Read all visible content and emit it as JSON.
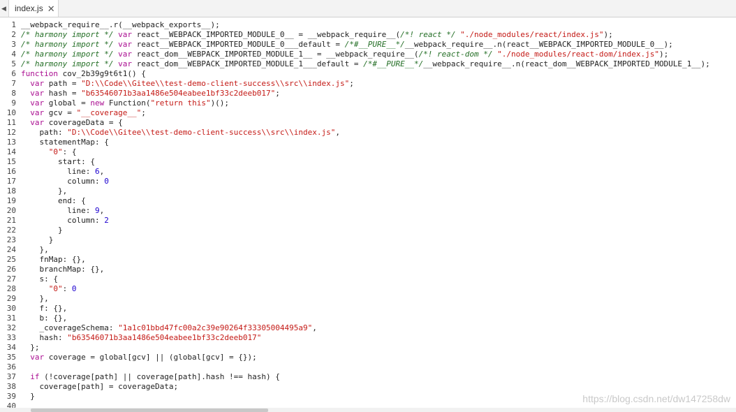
{
  "tab": {
    "filename": "index.js",
    "close_glyph": "✕",
    "toggle_glyph": "◀"
  },
  "watermark": "https://blog.csdn.net/dw147258dw",
  "lines": [
    [
      [
        "id",
        "__webpack_require__.r(__webpack_exports__);"
      ]
    ],
    [
      [
        "cm",
        "/* harmony import */ "
      ],
      [
        "kw",
        "var "
      ],
      [
        "id",
        "react__WEBPACK_IMPORTED_MODULE_0__ = __webpack_require__("
      ],
      [
        "cm",
        "/*! react */ "
      ],
      [
        "str",
        "\"./node_modules/react/index.js\""
      ],
      [
        "id",
        ");"
      ]
    ],
    [
      [
        "cm",
        "/* harmony import */ "
      ],
      [
        "kw",
        "var "
      ],
      [
        "id",
        "react__WEBPACK_IMPORTED_MODULE_0___default = "
      ],
      [
        "cm",
        "/*#__PURE__*/"
      ],
      [
        "id",
        "__webpack_require__.n(react__WEBPACK_IMPORTED_MODULE_0__);"
      ]
    ],
    [
      [
        "cm",
        "/* harmony import */ "
      ],
      [
        "kw",
        "var "
      ],
      [
        "id",
        "react_dom__WEBPACK_IMPORTED_MODULE_1__ = __webpack_require__("
      ],
      [
        "cm",
        "/*! react-dom */ "
      ],
      [
        "str",
        "\"./node_modules/react-dom/index.js\""
      ],
      [
        "id",
        ");"
      ]
    ],
    [
      [
        "cm",
        "/* harmony import */ "
      ],
      [
        "kw",
        "var "
      ],
      [
        "id",
        "react_dom__WEBPACK_IMPORTED_MODULE_1___default = "
      ],
      [
        "cm",
        "/*#__PURE__*/"
      ],
      [
        "id",
        "__webpack_require__.n(react_dom__WEBPACK_IMPORTED_MODULE_1__);"
      ]
    ],
    [
      [
        "kw",
        "function "
      ],
      [
        "id",
        "cov_2b39g9t6t1() {"
      ]
    ],
    [
      [
        "id",
        "  "
      ],
      [
        "kw",
        "var "
      ],
      [
        "id",
        "path = "
      ],
      [
        "str",
        "\"D:\\\\Code\\\\Gitee\\\\test-demo-client-success\\\\src\\\\index.js\""
      ],
      [
        "id",
        ";"
      ]
    ],
    [
      [
        "id",
        "  "
      ],
      [
        "kw",
        "var "
      ],
      [
        "id",
        "hash = "
      ],
      [
        "str",
        "\"b63546071b3aa1486e504eabee1bf33c2deeb017\""
      ],
      [
        "id",
        ";"
      ]
    ],
    [
      [
        "id",
        "  "
      ],
      [
        "kw",
        "var "
      ],
      [
        "id",
        "global = "
      ],
      [
        "kw",
        "new "
      ],
      [
        "id",
        "Function("
      ],
      [
        "str",
        "\"return this\""
      ],
      [
        "id",
        ")();"
      ]
    ],
    [
      [
        "id",
        "  "
      ],
      [
        "kw",
        "var "
      ],
      [
        "id",
        "gcv = "
      ],
      [
        "str",
        "\"__coverage__\""
      ],
      [
        "id",
        ";"
      ]
    ],
    [
      [
        "id",
        "  "
      ],
      [
        "kw",
        "var "
      ],
      [
        "id",
        "coverageData = {"
      ]
    ],
    [
      [
        "id",
        "    path: "
      ],
      [
        "str",
        "\"D:\\\\Code\\\\Gitee\\\\test-demo-client-success\\\\src\\\\index.js\""
      ],
      [
        "id",
        ","
      ]
    ],
    [
      [
        "id",
        "    statementMap: {"
      ]
    ],
    [
      [
        "id",
        "      "
      ],
      [
        "str",
        "\"0\""
      ],
      [
        "id",
        ": {"
      ]
    ],
    [
      [
        "id",
        "        start: {"
      ]
    ],
    [
      [
        "id",
        "          line: "
      ],
      [
        "num",
        "6"
      ],
      [
        "id",
        ","
      ]
    ],
    [
      [
        "id",
        "          column: "
      ],
      [
        "num",
        "0"
      ]
    ],
    [
      [
        "id",
        "        },"
      ]
    ],
    [
      [
        "id",
        "        end: {"
      ]
    ],
    [
      [
        "id",
        "          line: "
      ],
      [
        "num",
        "9"
      ],
      [
        "id",
        ","
      ]
    ],
    [
      [
        "id",
        "          column: "
      ],
      [
        "num",
        "2"
      ]
    ],
    [
      [
        "id",
        "        }"
      ]
    ],
    [
      [
        "id",
        "      }"
      ]
    ],
    [
      [
        "id",
        "    },"
      ]
    ],
    [
      [
        "id",
        "    fnMap: {},"
      ]
    ],
    [
      [
        "id",
        "    branchMap: {},"
      ]
    ],
    [
      [
        "id",
        "    s: {"
      ]
    ],
    [
      [
        "id",
        "      "
      ],
      [
        "str",
        "\"0\""
      ],
      [
        "id",
        ": "
      ],
      [
        "num",
        "0"
      ]
    ],
    [
      [
        "id",
        "    },"
      ]
    ],
    [
      [
        "id",
        "    f: {},"
      ]
    ],
    [
      [
        "id",
        "    b: {},"
      ]
    ],
    [
      [
        "id",
        "    _coverageSchema: "
      ],
      [
        "str",
        "\"1a1c01bbd47fc00a2c39e90264f33305004495a9\""
      ],
      [
        "id",
        ","
      ]
    ],
    [
      [
        "id",
        "    hash: "
      ],
      [
        "str",
        "\"b63546071b3aa1486e504eabee1bf33c2deeb017\""
      ]
    ],
    [
      [
        "id",
        "  };"
      ]
    ],
    [
      [
        "id",
        "  "
      ],
      [
        "kw",
        "var "
      ],
      [
        "id",
        "coverage = global[gcv] || (global[gcv] = {});"
      ]
    ],
    [
      [
        "id",
        ""
      ]
    ],
    [
      [
        "id",
        "  "
      ],
      [
        "kw",
        "if "
      ],
      [
        "id",
        "(!coverage[path] || coverage[path].hash !== hash) {"
      ]
    ],
    [
      [
        "id",
        "    coverage[path] = coverageData;"
      ]
    ],
    [
      [
        "id",
        "  }"
      ]
    ],
    [
      [
        "id",
        ""
      ]
    ]
  ]
}
